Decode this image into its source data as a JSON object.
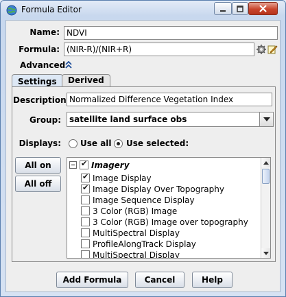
{
  "window": {
    "title": "Formula Editor"
  },
  "form": {
    "name_label": "Name:",
    "name_value": "NDVI",
    "formula_label": "Formula:",
    "formula_value": "(NIR-R)/(NIR+R)",
    "advanced_label": "Advanced"
  },
  "tabs": [
    {
      "label": "Settings",
      "active": true
    },
    {
      "label": "Derived",
      "active": false
    }
  ],
  "settings": {
    "description_label": "Description:",
    "description_value": "Normalized Difference Vegetation Index",
    "group_label": "Group:",
    "group_value": "satellite land surface obs",
    "displays_label": "Displays:",
    "use_all_label": "Use all",
    "use_selected_label": "Use selected:",
    "selected_mode": "use_selected",
    "all_on_label": "All on",
    "all_off_label": "All off"
  },
  "display_list": {
    "category": {
      "label": "Imagery",
      "checked": true,
      "expanded": true
    },
    "items": [
      {
        "label": "Image Display",
        "checked": true
      },
      {
        "label": "Image Display Over Topography",
        "checked": true
      },
      {
        "label": "Image Sequence Display",
        "checked": false
      },
      {
        "label": "3 Color (RGB) Image",
        "checked": false
      },
      {
        "label": "3 Color (RGB) Image over topography",
        "checked": false
      },
      {
        "label": "MultiSpectral Display",
        "checked": false
      },
      {
        "label": "ProfileAlongTrack Display",
        "checked": false
      },
      {
        "label": "MultiSpectral Display",
        "checked": false
      }
    ]
  },
  "buttons": {
    "add_formula": "Add Formula",
    "cancel": "Cancel",
    "help": "Help"
  },
  "colors": {
    "titlebar": "#c8d8ee",
    "close_button": "#c9452d",
    "tab_active": "#dde8f5"
  },
  "icons": {
    "app": "globe-icon",
    "formula_settings": "gear-icon",
    "formula_edit": "pencil-icon",
    "advanced_toggle": "chevron-double-up-icon"
  }
}
